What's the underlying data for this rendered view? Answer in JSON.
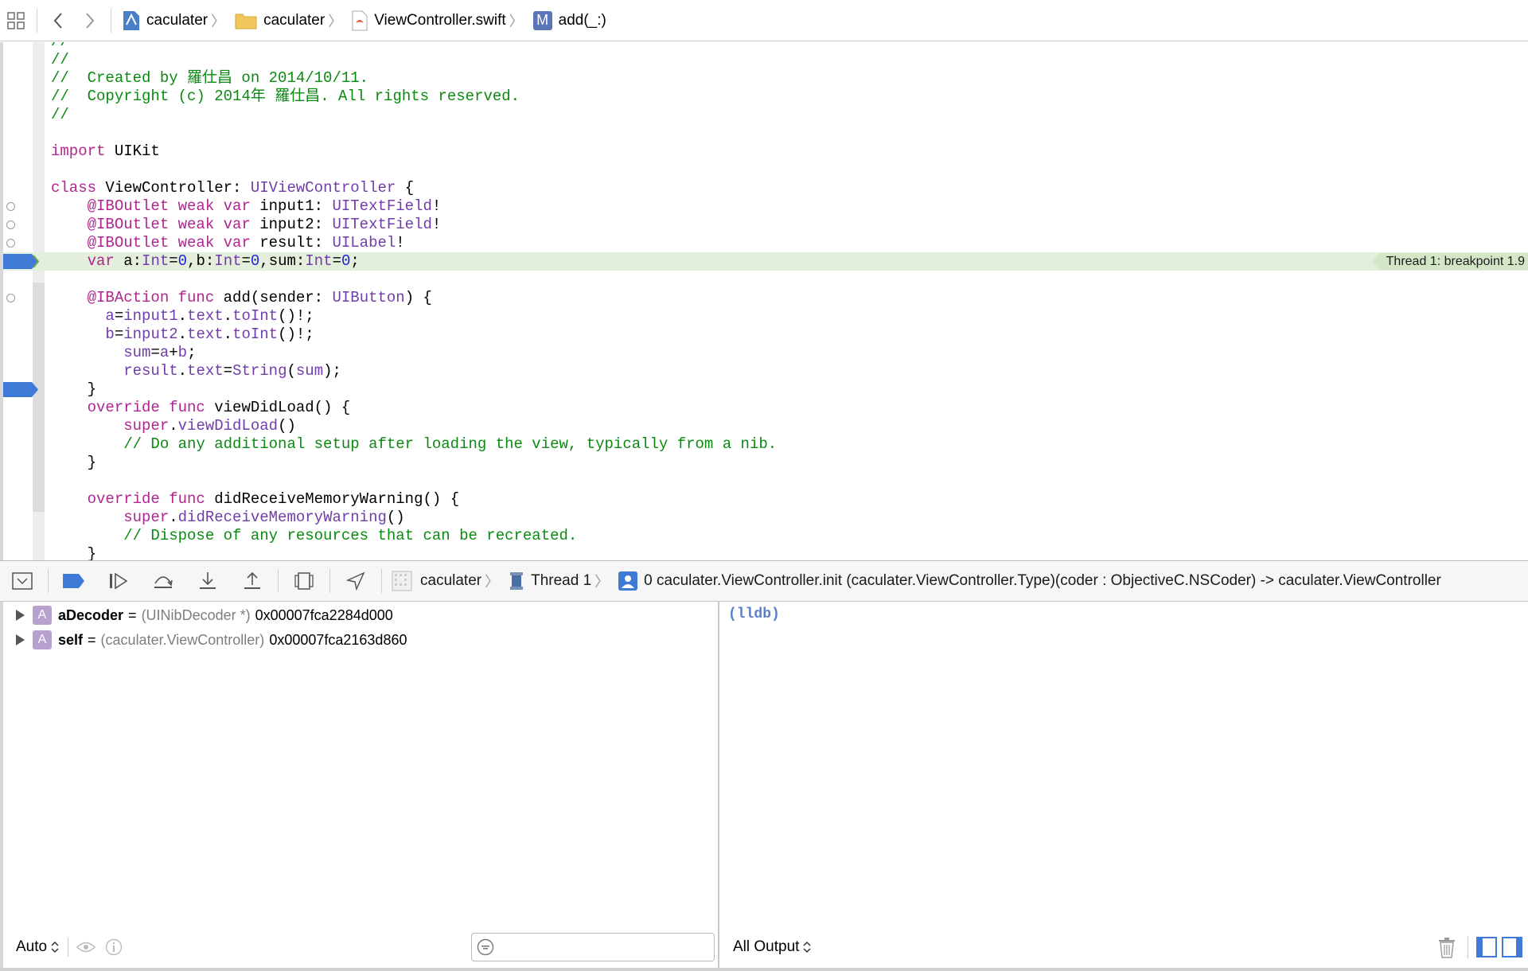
{
  "jumpbar": {
    "crumbs": [
      {
        "label": "caculater",
        "icon": "project-icon"
      },
      {
        "label": "caculater",
        "icon": "folder-icon"
      },
      {
        "label": "ViewController.swift",
        "icon": "swift-file-icon"
      },
      {
        "label": "add(_:)",
        "icon": "method-icon",
        "badge": "M"
      }
    ]
  },
  "editor": {
    "thread_badge": "Thread 1: breakpoint 1.9",
    "lines": [
      {
        "text": "//"
      },
      {
        "text": "//  Created by 羅仕昌 on 2014/10/11."
      },
      {
        "text": "//  Copyright (c) 2014年 羅仕昌. All rights reserved."
      },
      {
        "text": "//"
      },
      {
        "text": ""
      },
      {
        "text": "import UIKit"
      },
      {
        "text": ""
      },
      {
        "text": "class ViewController: UIViewController {"
      },
      {
        "text": "    @IBOutlet weak var input1: UITextField!"
      },
      {
        "text": "    @IBOutlet weak var input2: UITextField!"
      },
      {
        "text": "    @IBOutlet weak var result: UILabel!"
      },
      {
        "text": "    var a:Int=0,b:Int=0,sum:Int=0;"
      },
      {
        "text": ""
      },
      {
        "text": "    @IBAction func add(sender: UIButton) {"
      },
      {
        "text": "      a=input1.text.toInt()!;"
      },
      {
        "text": "      b=input2.text.toInt()!;"
      },
      {
        "text": "        sum=a+b;"
      },
      {
        "text": "        result.text=String(sum);"
      },
      {
        "text": "    }"
      },
      {
        "text": "    override func viewDidLoad() {"
      },
      {
        "text": "        super.viewDidLoad()"
      },
      {
        "text": "        // Do any additional setup after loading the view, typically from a nib."
      },
      {
        "text": "    }"
      },
      {
        "text": ""
      },
      {
        "text": "    override func didReceiveMemoryWarning() {"
      },
      {
        "text": "        super.didReceiveMemoryWarning()"
      },
      {
        "text": "        // Dispose of any resources that can be recreated."
      },
      {
        "text": "    }"
      }
    ]
  },
  "debugbar": {
    "target": "caculater",
    "thread": "Thread 1",
    "frame": "0 caculater.ViewController.init (caculater.ViewController.Type)(coder : ObjectiveC.NSCoder) -> caculater.ViewController"
  },
  "variables": {
    "rows": [
      {
        "badge": "A",
        "name": "aDecoder",
        "eq": "=",
        "type": "(UINibDecoder *)",
        "value": "0x00007fca2284d000"
      },
      {
        "badge": "A",
        "name": "self",
        "eq": "=",
        "type": "(caculater.ViewController)",
        "value": "0x00007fca2163d860"
      }
    ],
    "scope_select": "Auto"
  },
  "console": {
    "prompt": "(lldb)",
    "output_select": "All Output"
  },
  "colors": {
    "keyword": "#b0258f",
    "type": "#703daa",
    "number": "#1e22d8",
    "comment": "#0b8a12",
    "current_line": "#e3eedb",
    "breakpoint": "#3f7bd6"
  }
}
